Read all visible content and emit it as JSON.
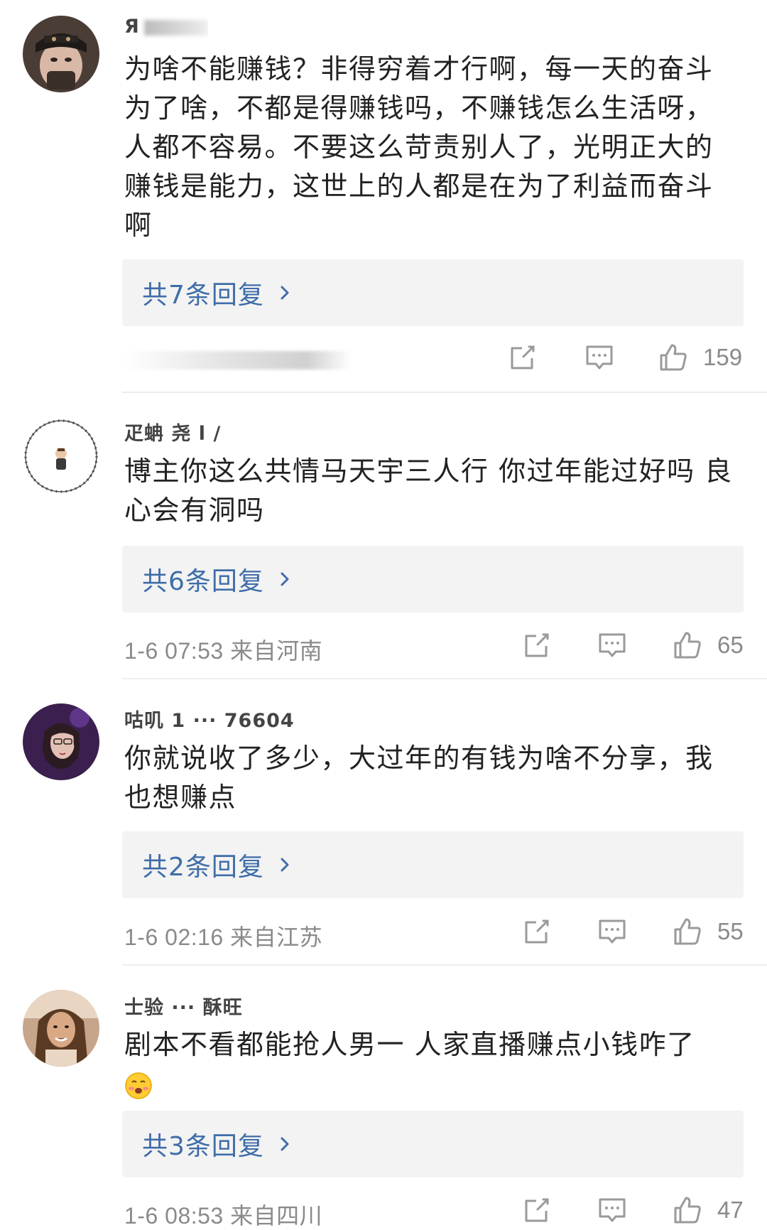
{
  "comments": [
    {
      "username": "Я",
      "text": "为啥不能赚钱？非得穷着才行啊，每一天的奋斗为了啥，不都是得赚钱吗，不赚钱怎么生活呀，人都不容易。不要这么苛责别人了，光明正大的赚钱是能力，这世上的人都是在为了利益而奋斗啊",
      "replies": "共7条回复",
      "time": "",
      "likes": "159"
    },
    {
      "username": "疋蚺 尧 l /",
      "text": "博主你这么共情马天宇三人行 你过年能过好吗 良心会有洞吗",
      "replies": "共6条回复",
      "time": "1-6 07:53 来自河南",
      "likes": "65"
    },
    {
      "username": "咕叽 1 ··· 76604",
      "text": "你就说收了多少，大过年的有钱为啥不分享，我也想赚点",
      "replies": "共2条回复",
      "time": "1-6 02:16 来自江苏",
      "likes": "55"
    },
    {
      "username": "士验 ··· 酥旺",
      "text": "剧本不看都能抢人男一 人家直播赚点小钱咋了",
      "replies": "共3条回复",
      "time": "1-6 08:53 来自四川",
      "likes": "47"
    }
  ],
  "icons": {
    "share": "share-icon",
    "comment": "comment-icon",
    "like": "thumbs-up-icon",
    "chevron": "chevron-right-icon",
    "emoji": "blushing-emoji-icon"
  },
  "colors": {
    "reply_link": "#3f6da8",
    "reply_bg": "#f3f3f3",
    "meta_text": "#8a8a8a"
  }
}
